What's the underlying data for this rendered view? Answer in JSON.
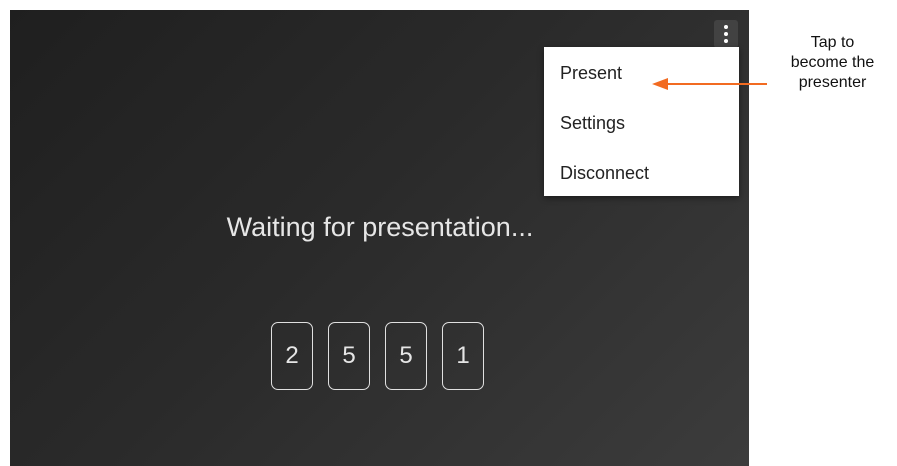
{
  "menu": {
    "items": [
      {
        "label": "Present"
      },
      {
        "label": "Settings"
      },
      {
        "label": "Disconnect"
      }
    ]
  },
  "main": {
    "status_text": "Waiting for presentation...",
    "code_digits": [
      "2",
      "5",
      "5",
      "1"
    ]
  },
  "annotation": {
    "lines": [
      "Tap to",
      "become the",
      "presenter"
    ],
    "arrow_color": "#f26b21"
  },
  "icons": {
    "overflow": "more-vert-icon"
  }
}
